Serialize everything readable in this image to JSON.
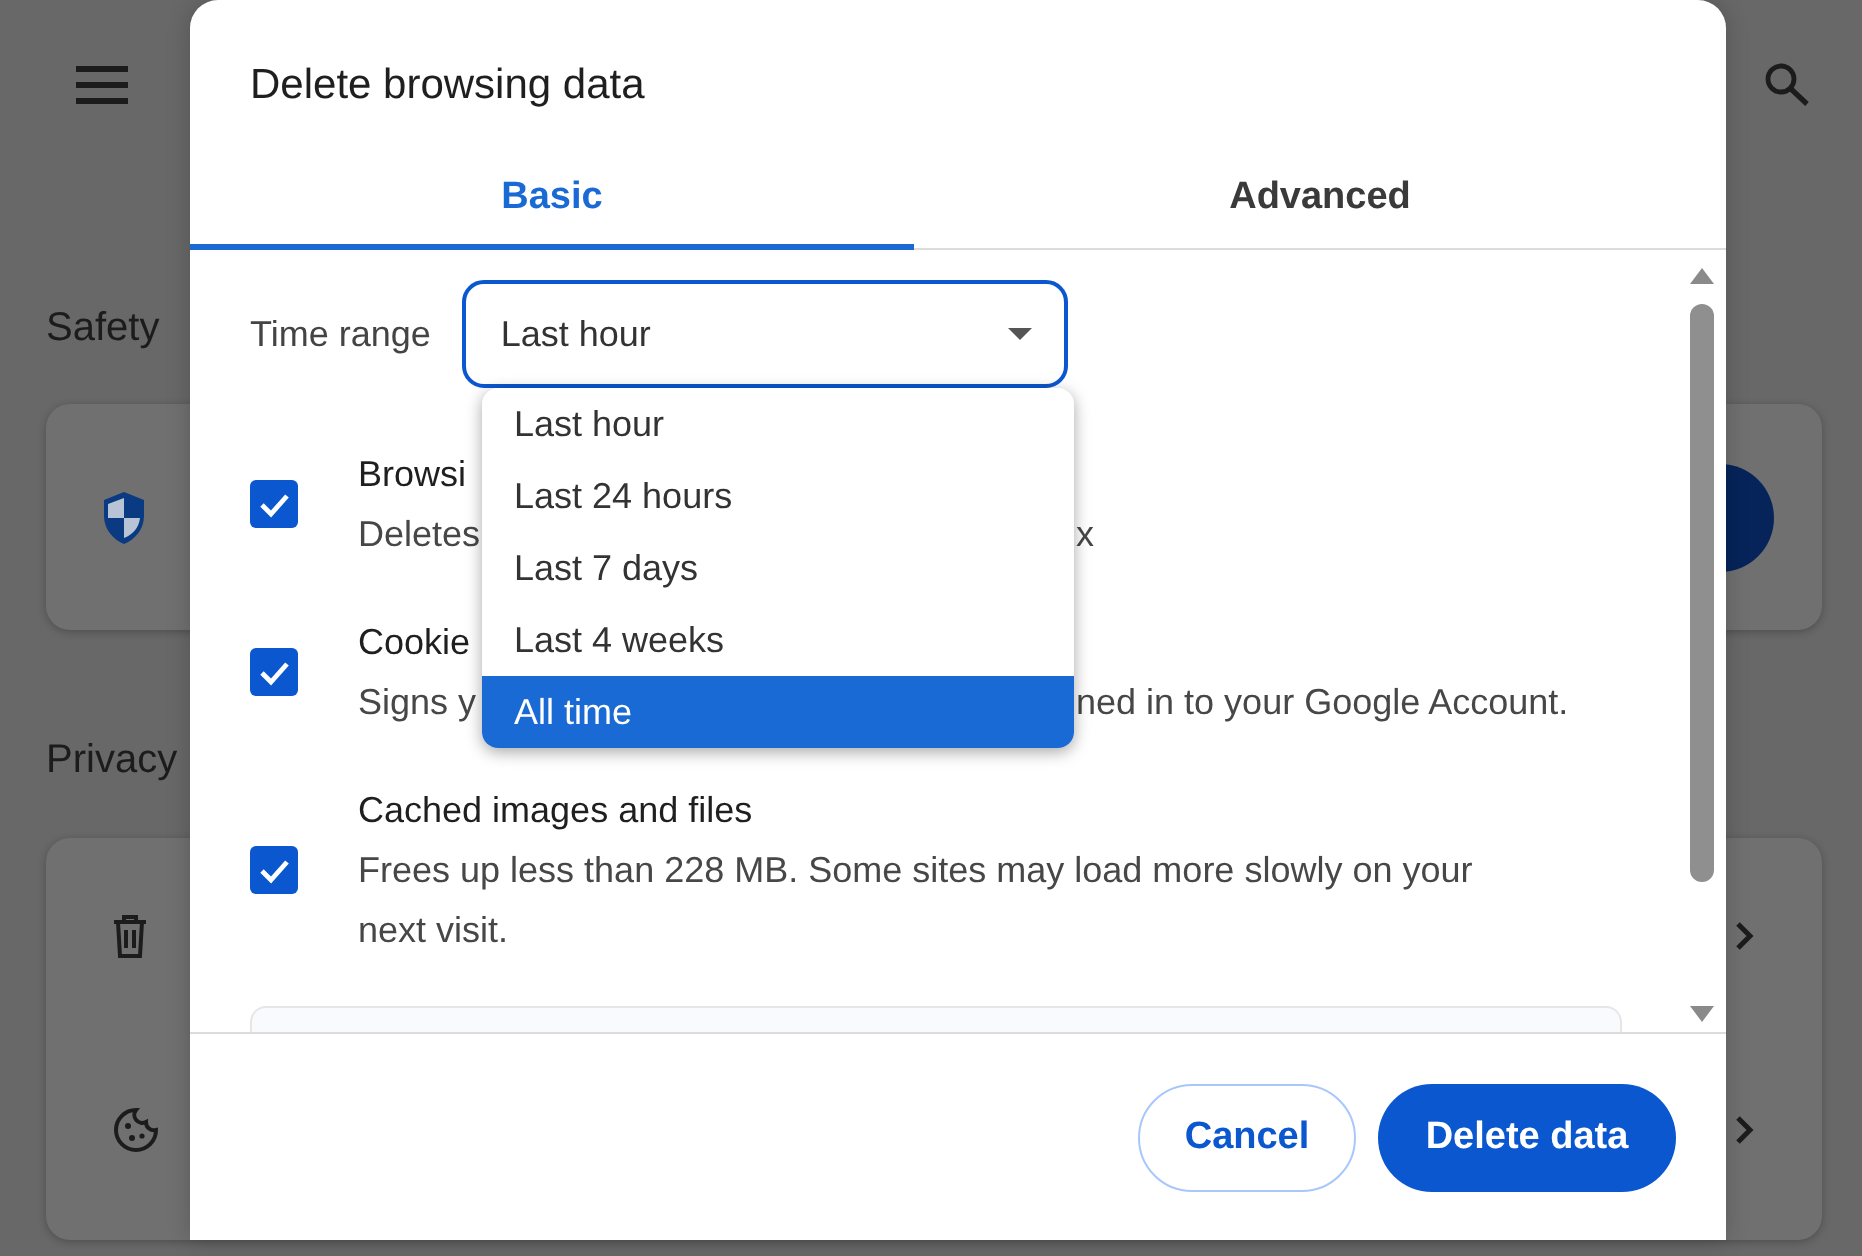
{
  "background": {
    "sections": [
      {
        "heading": "Safety",
        "kind": "safety"
      },
      {
        "heading": "Privacy",
        "kind": "privacy"
      }
    ]
  },
  "dialog": {
    "title": "Delete browsing data",
    "tabs": [
      {
        "label": "Basic",
        "selected": true
      },
      {
        "label": "Advanced",
        "selected": false
      }
    ],
    "time_range": {
      "label": "Time range",
      "value": "Last hour",
      "options": [
        {
          "label": "Last hour",
          "highlighted": false
        },
        {
          "label": "Last 24 hours",
          "highlighted": false
        },
        {
          "label": "Last 7 days",
          "highlighted": false
        },
        {
          "label": "Last 4 weeks",
          "highlighted": false
        },
        {
          "label": "All time",
          "highlighted": true
        }
      ]
    },
    "items": [
      {
        "title": "Browsi",
        "description": "Deletes",
        "description_end": "x",
        "checked": true
      },
      {
        "title": "Cookie",
        "description": "Signs y",
        "description_end": "ned in to your Google Account.",
        "checked": true
      },
      {
        "title": "Cached images and files",
        "description": "Frees up less than 228 MB. Some sites may load more slowly on your next visit.",
        "checked": true
      }
    ],
    "buttons": [
      {
        "label": "Cancel",
        "kind": "secondary"
      },
      {
        "label": "Delete data",
        "kind": "primary"
      }
    ]
  }
}
